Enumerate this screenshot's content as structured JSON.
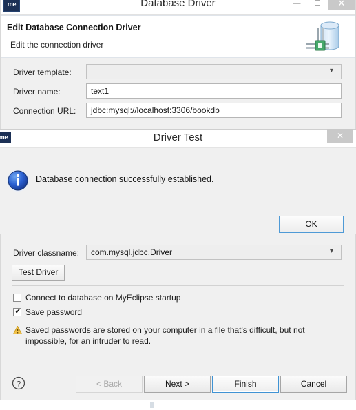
{
  "window": {
    "title": "Database Driver",
    "app_badge": "me",
    "minimize": "—",
    "maximize": "☐",
    "close": "×"
  },
  "banner": {
    "title": "Edit Database Connection Driver",
    "subtitle": "Edit the connection driver",
    "icon": "database-connection-icon"
  },
  "form": {
    "driver_template": {
      "label": "Driver template:",
      "value": "",
      "placeholder": ""
    },
    "driver_name": {
      "label": "Driver name:",
      "value": "text1"
    },
    "connection_url": {
      "label": "Connection URL:",
      "value": "jdbc:mysql://localhost:3306/bookdb"
    },
    "driver_classname": {
      "label": "Driver classname:",
      "value": "com.mysql.jdbc.Driver"
    },
    "test_driver_button": "Test Driver"
  },
  "options": {
    "connect_on_startup": {
      "label": "Connect to database on MyEclipse startup",
      "checked": false
    },
    "save_password": {
      "label": "Save password",
      "checked": true
    },
    "warning": "Saved passwords are stored on your computer in a file that's difficult, but not impossible, for an intruder to read."
  },
  "footer": {
    "help": "?",
    "back": "< Back",
    "next": "Next >",
    "finish": "Finish",
    "cancel": "Cancel"
  },
  "driver_test_dialog": {
    "title": "Driver Test",
    "app_badge": "me",
    "close": "×",
    "message": "Database connection successfully established.",
    "ok": "OK",
    "icon": "info-icon"
  },
  "colors": {
    "accent_blue": "#4e9ad6",
    "badge_navy": "#1c3055",
    "info_blue": "#1f4fc4",
    "warning_amber": "#e8a33d",
    "window_bg": "#f0f0f0"
  }
}
